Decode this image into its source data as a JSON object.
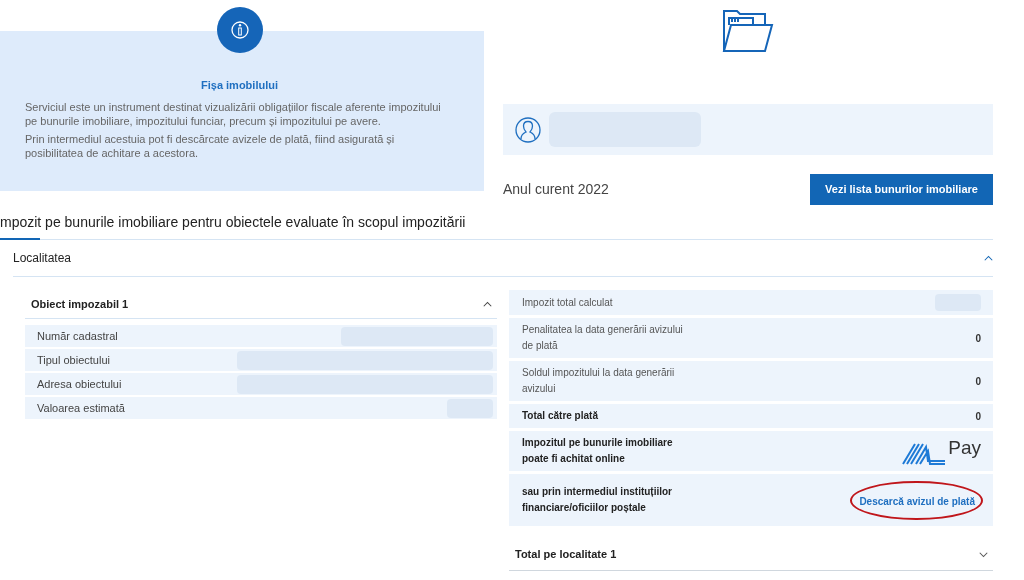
{
  "info_card": {
    "title": "Fișa imobilului",
    "paragraphs": [
      "Serviciul este un instrument destinat vizualizării obligațiilor fiscale aferente impozitului pe bunurile imobiliare, impozitului funciar, precum și impozitului pe avere.",
      "Prin intermediul acestuia pot fi descărcate avizele de plată, fiind asigurată și posibilitatea de achitare a acestora."
    ]
  },
  "user_bar": {
    "name_redacted": true
  },
  "year_label": "Anul curent 2022",
  "list_button": "Vezi lista bunurilor imobiliare",
  "section_title": "mpozit pe bunurile imobiliare pentru obiectele evaluate în scopul impozitării",
  "locality": {
    "label": "Localitatea",
    "expanded": true
  },
  "object_panel": {
    "title": "Obiect impozabil 1",
    "expanded": true,
    "rows": [
      {
        "label": "Număr cadastral",
        "redacted": true
      },
      {
        "label": "Tipul obiectului",
        "redacted": true
      },
      {
        "label": "Adresa obiectului",
        "redacted": true
      },
      {
        "label": "Valoarea estimată",
        "redacted": true
      }
    ]
  },
  "summary_rows": [
    {
      "kind": "value",
      "label": "Impozit total calculat",
      "redacted": true
    },
    {
      "kind": "value",
      "label": "Penalitatea la data generării avizului de plată",
      "value": "0",
      "redacted": false
    },
    {
      "kind": "value",
      "label": "Soldul impozitului la data generării avizului",
      "value": "0",
      "redacted": false
    },
    {
      "kind": "total",
      "label": "Total către plată",
      "value": "0",
      "redacted": false
    },
    {
      "kind": "logo",
      "label": "Impozitul pe bunurile imobiliare poate fi achitat online",
      "logo_text": "Pay"
    },
    {
      "kind": "link",
      "label": "sau prin intermediul instituțiilor financiare/oficiilor poștale",
      "link": "Descarcă avizul de plată",
      "circled": true
    }
  ],
  "locality_total": {
    "label": "Total pe localitate 1",
    "expanded": false
  }
}
